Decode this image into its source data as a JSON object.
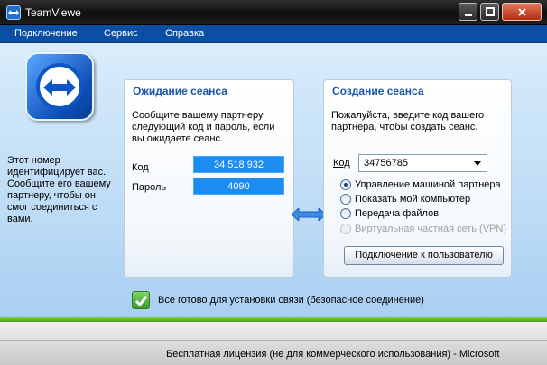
{
  "window": {
    "title": "TeamViewe",
    "minimize_glyph": "_",
    "close_glyph": "X"
  },
  "menu": {
    "items": [
      "Подключение",
      "Сервис",
      "Справка"
    ]
  },
  "sidebar": {
    "info_lines": [
      "Этот номер",
      "идентифицирует вас.",
      "Сообщите его вашему",
      "партнеру, чтобы он",
      "смог соединиться с",
      "вами."
    ]
  },
  "wait_panel": {
    "title": "Ожидание сеанса",
    "desc_lines": [
      "Сообщите вашему партнеру",
      "следующий код и пароль, если",
      "вы ожидаете сеанс."
    ],
    "id_label": "Код",
    "id_value": "34 518 932",
    "password_label": "Пароль",
    "password_value": "4090"
  },
  "create_panel": {
    "title": "Создание сеанса",
    "desc_lines": [
      "Пожалуйста, введите код вашего",
      "партнера, чтобы создать сеанс."
    ],
    "id_label": "Код",
    "id_value": "34756785",
    "options": [
      {
        "label": "Управление машиной партнера",
        "selected": true,
        "disabled": false
      },
      {
        "label": "Показать мой компьютер",
        "selected": false,
        "disabled": false
      },
      {
        "label": "Передача файлов",
        "selected": false,
        "disabled": false
      },
      {
        "label": "Виртуальная частная сеть (VPN)",
        "selected": false,
        "disabled": true
      }
    ],
    "connect_label": "Подключение к пользователю"
  },
  "status": {
    "text": "Все готово для установки связи (безопасное соединение)"
  },
  "footer": {
    "license_text": "Бесплатная лицензия (не для коммерческого использования) - Microsoft"
  },
  "colors": {
    "menu_bg": "#0a4fa3",
    "accent_blue": "#1c8df0",
    "status_green": "#4ea21e"
  }
}
